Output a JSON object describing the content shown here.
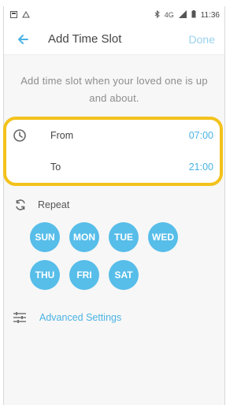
{
  "status_bar": {
    "left_icons": [
      "sim-card-icon",
      "alarm-icon"
    ],
    "right_icons": [
      "bluetooth-icon",
      "data-icon",
      "signal-icon",
      "battery-icon"
    ],
    "data_label": "4G",
    "time": "11:36"
  },
  "app_bar": {
    "title": "Add Time Slot",
    "done_label": "Done",
    "back_icon": "arrow-left-icon"
  },
  "hint": "Add time slot when your loved one is up and about.",
  "time_slot": {
    "from_label": "From",
    "from_value": "07:00",
    "to_label": "To",
    "to_value": "21:00",
    "highlight_color": "#f3c21c"
  },
  "repeat": {
    "label": "Repeat",
    "days": [
      "SUN",
      "MON",
      "TUE",
      "WED",
      "THU",
      "FRI",
      "SAT"
    ],
    "day_color": "#57bde9"
  },
  "advanced": {
    "label": "Advanced Settings"
  },
  "colors": {
    "accent": "#4bb3e4"
  }
}
